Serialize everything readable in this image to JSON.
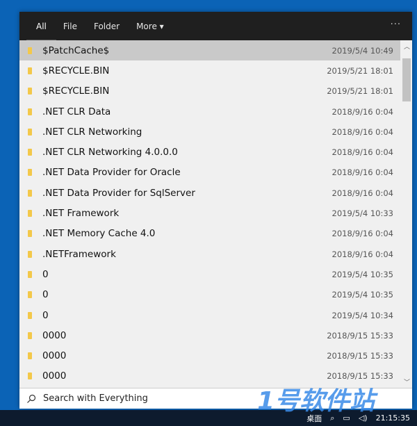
{
  "tabs": [
    {
      "label": "All"
    },
    {
      "label": "File"
    },
    {
      "label": "Folder"
    },
    {
      "label": "More ▾"
    }
  ],
  "menu_label": "···",
  "rows": [
    {
      "name": "$PatchCache$",
      "date": "2019/5/4 10:49"
    },
    {
      "name": "$RECYCLE.BIN",
      "date": "2019/5/21 18:01"
    },
    {
      "name": "$RECYCLE.BIN",
      "date": "2019/5/21 18:01"
    },
    {
      "name": ".NET CLR Data",
      "date": "2018/9/16 0:04"
    },
    {
      "name": ".NET CLR Networking",
      "date": "2018/9/16 0:04"
    },
    {
      "name": ".NET CLR Networking 4.0.0.0",
      "date": "2018/9/16 0:04"
    },
    {
      "name": ".NET Data Provider for Oracle",
      "date": "2018/9/16 0:04"
    },
    {
      "name": ".NET Data Provider for SqlServer",
      "date": "2018/9/16 0:04"
    },
    {
      "name": ".NET Framework",
      "date": "2019/5/4 10:33"
    },
    {
      "name": ".NET Memory Cache 4.0",
      "date": "2018/9/16 0:04"
    },
    {
      "name": ".NETFramework",
      "date": "2018/9/16 0:04"
    },
    {
      "name": "0",
      "date": "2019/5/4 10:35"
    },
    {
      "name": "0",
      "date": "2019/5/4 10:35"
    },
    {
      "name": "0",
      "date": "2019/5/4 10:34"
    },
    {
      "name": "0000",
      "date": "2018/9/15 15:33"
    },
    {
      "name": "0000",
      "date": "2018/9/15 15:33"
    },
    {
      "name": "0000",
      "date": "2018/9/15 15:33"
    }
  ],
  "search": {
    "placeholder": "Search with Everything"
  },
  "taskbar": {
    "desktop": "桌面",
    "clock": "21:15:35"
  },
  "watermark": "1号软件站",
  "colors": {
    "background": "#0b63b6",
    "header": "#1f1f1f",
    "folder": "#f3c84a"
  }
}
